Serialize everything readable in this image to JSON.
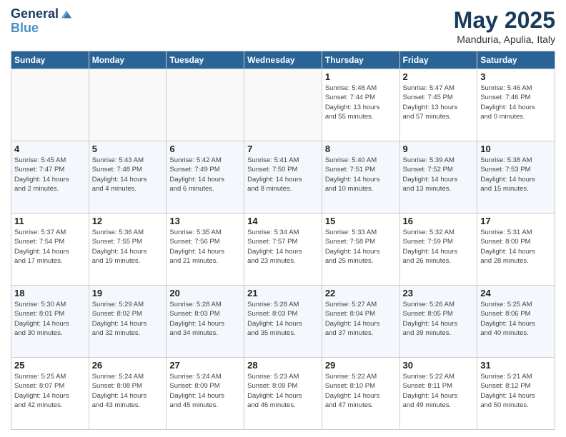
{
  "logo": {
    "line1": "General",
    "line2": "Blue"
  },
  "title": "May 2025",
  "subtitle": "Manduria, Apulia, Italy",
  "headers": [
    "Sunday",
    "Monday",
    "Tuesday",
    "Wednesday",
    "Thursday",
    "Friday",
    "Saturday"
  ],
  "rows": [
    [
      {
        "day": "",
        "info": ""
      },
      {
        "day": "",
        "info": ""
      },
      {
        "day": "",
        "info": ""
      },
      {
        "day": "",
        "info": ""
      },
      {
        "day": "1",
        "info": "Sunrise: 5:48 AM\nSunset: 7:44 PM\nDaylight: 13 hours\nand 55 minutes."
      },
      {
        "day": "2",
        "info": "Sunrise: 5:47 AM\nSunset: 7:45 PM\nDaylight: 13 hours\nand 57 minutes."
      },
      {
        "day": "3",
        "info": "Sunrise: 5:46 AM\nSunset: 7:46 PM\nDaylight: 14 hours\nand 0 minutes."
      }
    ],
    [
      {
        "day": "4",
        "info": "Sunrise: 5:45 AM\nSunset: 7:47 PM\nDaylight: 14 hours\nand 2 minutes."
      },
      {
        "day": "5",
        "info": "Sunrise: 5:43 AM\nSunset: 7:48 PM\nDaylight: 14 hours\nand 4 minutes."
      },
      {
        "day": "6",
        "info": "Sunrise: 5:42 AM\nSunset: 7:49 PM\nDaylight: 14 hours\nand 6 minutes."
      },
      {
        "day": "7",
        "info": "Sunrise: 5:41 AM\nSunset: 7:50 PM\nDaylight: 14 hours\nand 8 minutes."
      },
      {
        "day": "8",
        "info": "Sunrise: 5:40 AM\nSunset: 7:51 PM\nDaylight: 14 hours\nand 10 minutes."
      },
      {
        "day": "9",
        "info": "Sunrise: 5:39 AM\nSunset: 7:52 PM\nDaylight: 14 hours\nand 13 minutes."
      },
      {
        "day": "10",
        "info": "Sunrise: 5:38 AM\nSunset: 7:53 PM\nDaylight: 14 hours\nand 15 minutes."
      }
    ],
    [
      {
        "day": "11",
        "info": "Sunrise: 5:37 AM\nSunset: 7:54 PM\nDaylight: 14 hours\nand 17 minutes."
      },
      {
        "day": "12",
        "info": "Sunrise: 5:36 AM\nSunset: 7:55 PM\nDaylight: 14 hours\nand 19 minutes."
      },
      {
        "day": "13",
        "info": "Sunrise: 5:35 AM\nSunset: 7:56 PM\nDaylight: 14 hours\nand 21 minutes."
      },
      {
        "day": "14",
        "info": "Sunrise: 5:34 AM\nSunset: 7:57 PM\nDaylight: 14 hours\nand 23 minutes."
      },
      {
        "day": "15",
        "info": "Sunrise: 5:33 AM\nSunset: 7:58 PM\nDaylight: 14 hours\nand 25 minutes."
      },
      {
        "day": "16",
        "info": "Sunrise: 5:32 AM\nSunset: 7:59 PM\nDaylight: 14 hours\nand 26 minutes."
      },
      {
        "day": "17",
        "info": "Sunrise: 5:31 AM\nSunset: 8:00 PM\nDaylight: 14 hours\nand 28 minutes."
      }
    ],
    [
      {
        "day": "18",
        "info": "Sunrise: 5:30 AM\nSunset: 8:01 PM\nDaylight: 14 hours\nand 30 minutes."
      },
      {
        "day": "19",
        "info": "Sunrise: 5:29 AM\nSunset: 8:02 PM\nDaylight: 14 hours\nand 32 minutes."
      },
      {
        "day": "20",
        "info": "Sunrise: 5:28 AM\nSunset: 8:03 PM\nDaylight: 14 hours\nand 34 minutes."
      },
      {
        "day": "21",
        "info": "Sunrise: 5:28 AM\nSunset: 8:03 PM\nDaylight: 14 hours\nand 35 minutes."
      },
      {
        "day": "22",
        "info": "Sunrise: 5:27 AM\nSunset: 8:04 PM\nDaylight: 14 hours\nand 37 minutes."
      },
      {
        "day": "23",
        "info": "Sunrise: 5:26 AM\nSunset: 8:05 PM\nDaylight: 14 hours\nand 39 minutes."
      },
      {
        "day": "24",
        "info": "Sunrise: 5:25 AM\nSunset: 8:06 PM\nDaylight: 14 hours\nand 40 minutes."
      }
    ],
    [
      {
        "day": "25",
        "info": "Sunrise: 5:25 AM\nSunset: 8:07 PM\nDaylight: 14 hours\nand 42 minutes."
      },
      {
        "day": "26",
        "info": "Sunrise: 5:24 AM\nSunset: 8:08 PM\nDaylight: 14 hours\nand 43 minutes."
      },
      {
        "day": "27",
        "info": "Sunrise: 5:24 AM\nSunset: 8:09 PM\nDaylight: 14 hours\nand 45 minutes."
      },
      {
        "day": "28",
        "info": "Sunrise: 5:23 AM\nSunset: 8:09 PM\nDaylight: 14 hours\nand 46 minutes."
      },
      {
        "day": "29",
        "info": "Sunrise: 5:22 AM\nSunset: 8:10 PM\nDaylight: 14 hours\nand 47 minutes."
      },
      {
        "day": "30",
        "info": "Sunrise: 5:22 AM\nSunset: 8:11 PM\nDaylight: 14 hours\nand 49 minutes."
      },
      {
        "day": "31",
        "info": "Sunrise: 5:21 AM\nSunset: 8:12 PM\nDaylight: 14 hours\nand 50 minutes."
      }
    ]
  ]
}
